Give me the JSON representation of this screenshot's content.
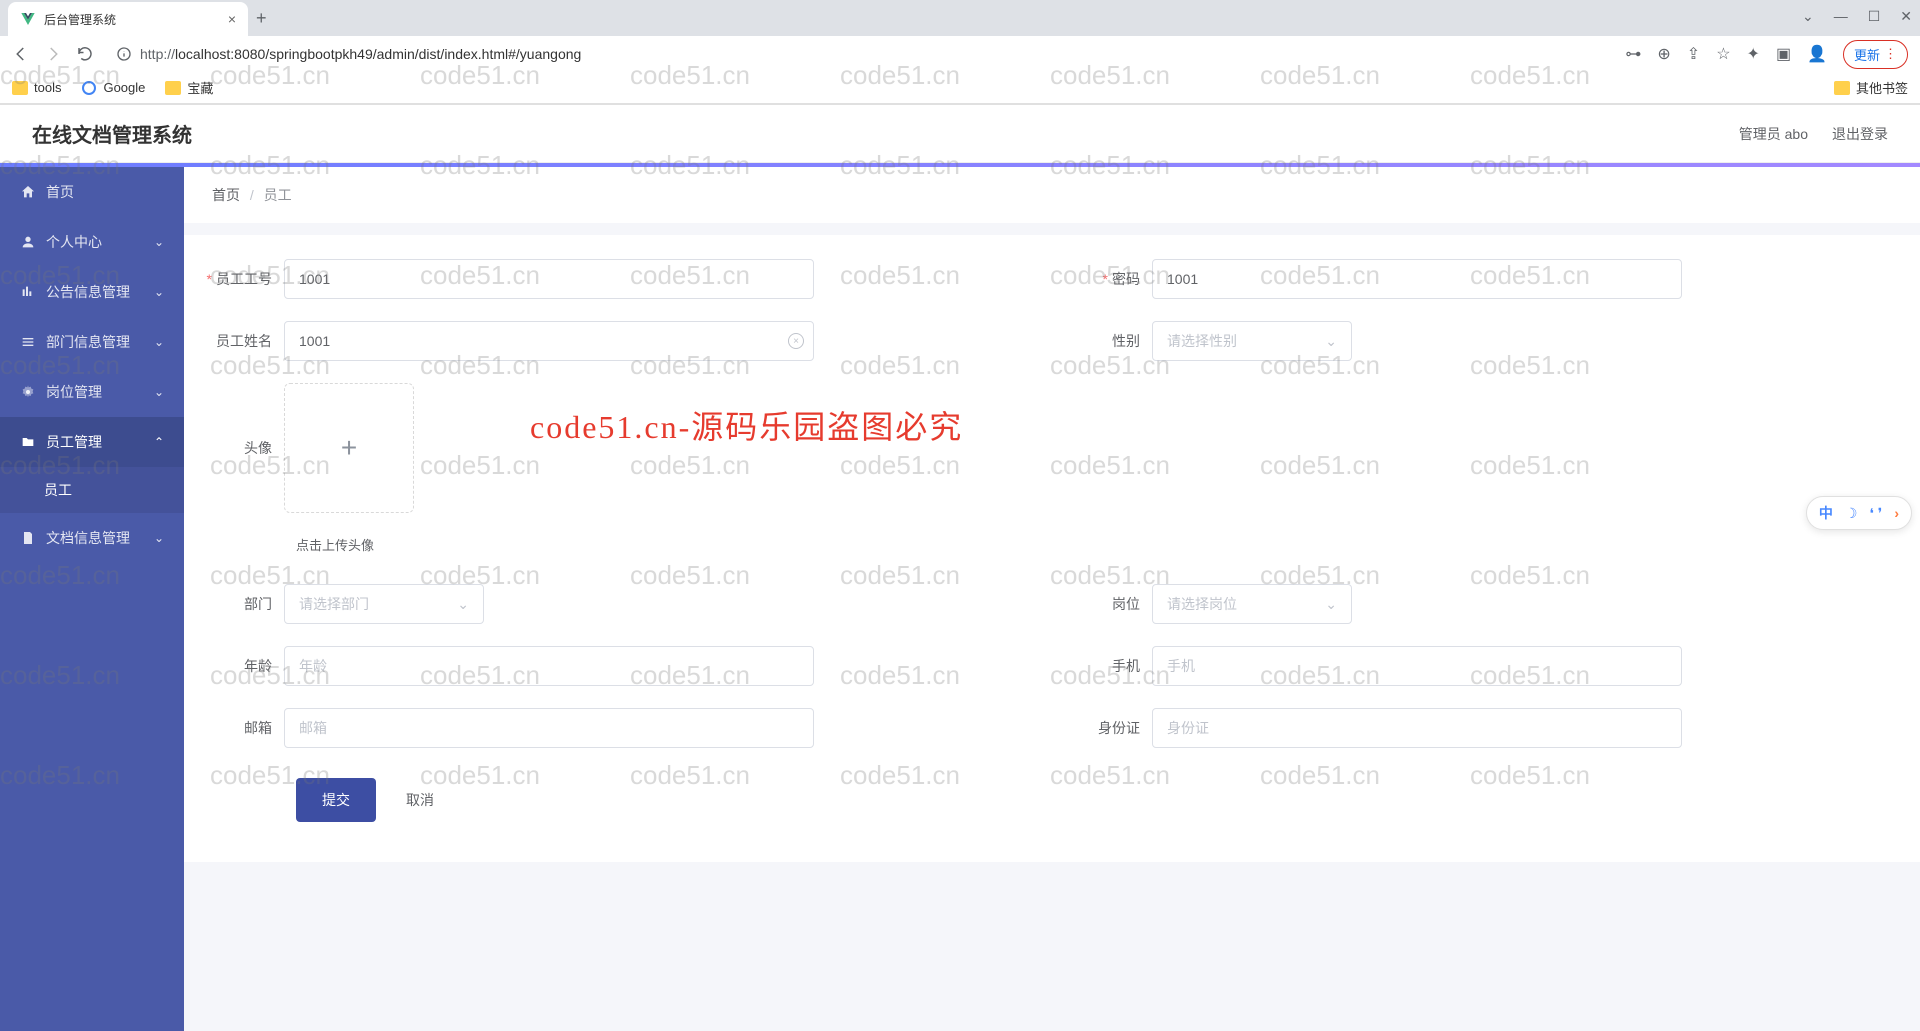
{
  "browser": {
    "tab_title": "后台管理系统",
    "url_proto": "http://",
    "url_rest": "localhost:8080/springbootpkh49/admin/dist/index.html#/yuangong",
    "update_label": "更新",
    "bookmarks": {
      "tools": "tools",
      "google": "Google",
      "treasure": "宝藏",
      "other": "其他书签"
    }
  },
  "header": {
    "app_title": "在线文档管理系统",
    "user_label": "管理员 abo",
    "logout": "退出登录"
  },
  "sidebar": {
    "home": "首页",
    "personal": "个人中心",
    "notice": "公告信息管理",
    "dept": "部门信息管理",
    "position": "岗位管理",
    "employee": "员工管理",
    "employee_sub": "员工",
    "doc": "文档信息管理"
  },
  "breadcrumb": {
    "home": "首页",
    "current": "员工"
  },
  "form": {
    "emp_id_label": "员工工号",
    "emp_id_value": "1001",
    "password_label": "密码",
    "password_value": "1001",
    "name_label": "员工姓名",
    "name_value": "1001",
    "gender_label": "性别",
    "gender_placeholder": "请选择性别",
    "avatar_label": "头像",
    "avatar_hint": "点击上传头像",
    "dept_label": "部门",
    "dept_placeholder": "请选择部门",
    "position_label": "岗位",
    "position_placeholder": "请选择岗位",
    "age_label": "年龄",
    "age_placeholder": "年龄",
    "phone_label": "手机",
    "phone_placeholder": "手机",
    "email_label": "邮箱",
    "email_placeholder": "邮箱",
    "idcard_label": "身份证",
    "idcard_placeholder": "身份证",
    "submit": "提交",
    "cancel": "取消"
  },
  "watermark": {
    "text": "code51.cn",
    "big": "code51.cn-源码乐园盗图必究"
  },
  "ime": {
    "cn": "中",
    "quotes": "‹ ›"
  }
}
